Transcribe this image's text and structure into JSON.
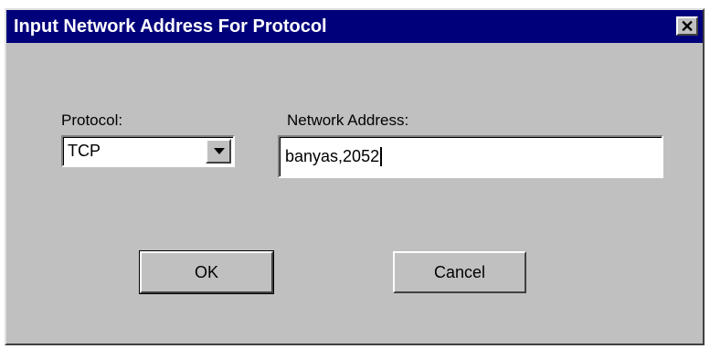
{
  "window": {
    "title": "Input Network Address For Protocol",
    "close_glyph": "✕"
  },
  "form": {
    "protocol_label": "Protocol:",
    "protocol_value": "TCP",
    "address_label": "Network Address:",
    "address_value": "banyas,2052"
  },
  "buttons": {
    "ok_label": "OK",
    "cancel_label": "Cancel"
  },
  "icons": {
    "close": "close-icon",
    "dropdown": "chevron-down-icon"
  },
  "colors": {
    "titlebar": "#00007b",
    "dialog_bg": "#c0c0c0",
    "field_bg": "#ffffff"
  }
}
